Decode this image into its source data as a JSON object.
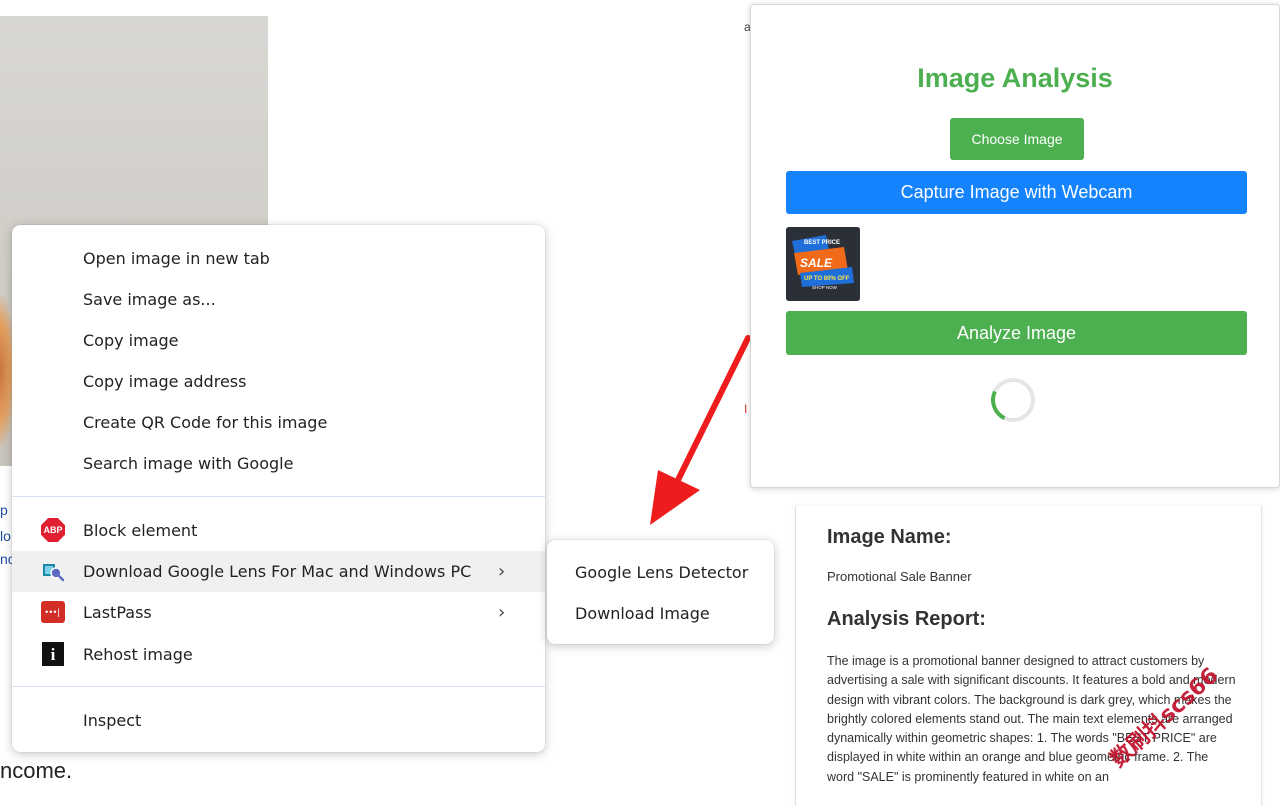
{
  "background_page": {
    "side_text": [
      "p",
      "lo",
      "nc"
    ],
    "bottom_text": "ncome.",
    "sliver_text": [
      "a",
      "I"
    ]
  },
  "context_menu": {
    "items": [
      {
        "label": "Open image in new tab"
      },
      {
        "label": "Save image as..."
      },
      {
        "label": "Copy image"
      },
      {
        "label": "Copy image address"
      },
      {
        "label": "Create QR Code for this image"
      },
      {
        "label": "Search image with Google"
      }
    ],
    "extensions": [
      {
        "label": "Block element",
        "icon": "abp-icon",
        "icon_text": "ABP"
      },
      {
        "label": "Download Google Lens For Mac and Windows PC",
        "icon": "google-lens-icon",
        "has_submenu": true
      },
      {
        "label": "LastPass",
        "icon": "lastpass-icon",
        "icon_text": "•••|",
        "has_submenu": true
      },
      {
        "label": "Rehost image",
        "icon": "rehost-icon",
        "icon_text": "i"
      }
    ],
    "inspect_label": "Inspect",
    "submenu_chevron": "›"
  },
  "submenu": {
    "items": [
      "Google Lens Detector",
      "Download Image"
    ]
  },
  "analysis_popup": {
    "title": "Image Analysis",
    "choose_button": "Choose Image",
    "webcam_button": "Capture Image with Webcam",
    "analyze_button": "Analyze Image",
    "thumbnail": {
      "line1": "BEST PRICE",
      "line2": "SALE",
      "line3": "UP TO 80% OFF",
      "line4": "SHOP NOW"
    },
    "accent_color": "#4caf50",
    "webcam_color": "#1483fd"
  },
  "result": {
    "name_heading": "Image Name:",
    "name_value": "Promotional Sale Banner",
    "report_heading": "Analysis Report:",
    "report_text": "The image is a promotional banner designed to attract customers by advertising a sale with significant discounts. It features a bold and modern design with vibrant colors. The background is dark grey, which makes the brightly colored elements stand out. The main text elements are arranged dynamically within geometric shapes: 1. The words \"BEST PRICE\" are displayed in white within an orange and blue geometric frame. 2. The word \"SALE\" is prominently featured in white on an"
  },
  "watermark": "数刷抖scs66"
}
